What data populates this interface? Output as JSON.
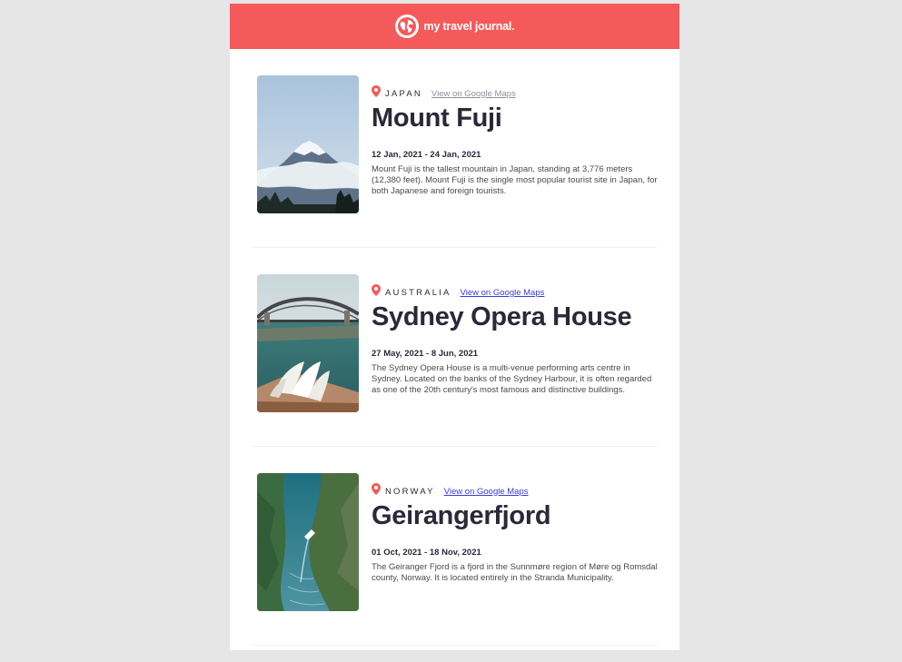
{
  "header": {
    "brand": "my travel journal.",
    "logo_icon": "globe-icon",
    "background_color": "#F55A5A"
  },
  "entries": [
    {
      "country": "JAPAN",
      "maps_link": "View on Google Maps",
      "title": "Mount Fuji",
      "dates": "12 Jan, 2021 - 24 Jan, 2021",
      "description": "Mount Fuji is the tallest mountain in Japan, standing at 3,776 meters (12,380 feet). Mount Fuji is the single most popular tourist site in Japan, for both Japanese and foreign tourists.",
      "image_subject": "snow-capped mountain"
    },
    {
      "country": "AUSTRALIA",
      "maps_link": "View on Google Maps",
      "title": "Sydney Opera House",
      "dates": "27 May, 2021 - 8 Jun, 2021",
      "description": "The Sydney Opera House is a multi-venue performing arts centre in Sydney. Located on the banks of the Sydney Harbour, it is often regarded as one of the 20th century's most famous and distinctive buildings.",
      "image_subject": "opera house and harbour bridge"
    },
    {
      "country": "NORWAY",
      "maps_link": "View on Google Maps",
      "title": "Geirangerfjord",
      "dates": "01 Oct, 2021 - 18 Nov, 2021",
      "description": "The Geiranger Fjord is a fjord in the Sunnmøre region of Møre og Romsdal county, Norway. It is located entirely in the Stranda Municipality.",
      "image_subject": "fjord with boat"
    }
  ],
  "colors": {
    "accent": "#F55A5A",
    "text": "#2B283A",
    "link": "#3B3BD6",
    "link_visited": "#918E9B"
  }
}
